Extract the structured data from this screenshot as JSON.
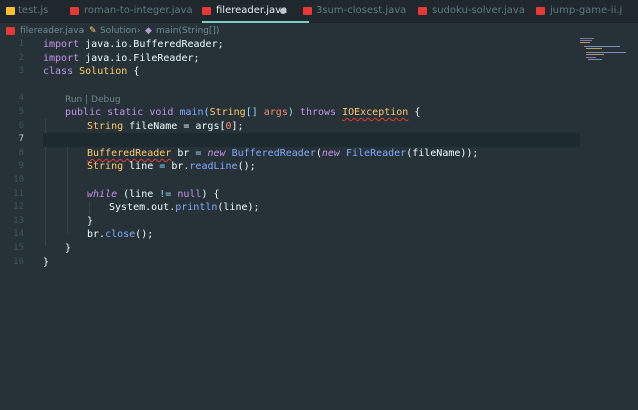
{
  "tabs": [
    {
      "label": "test.js",
      "icon": "js-file-icon",
      "active": false
    },
    {
      "label": "roman-to-integer.java",
      "icon": "java-file-icon",
      "active": false
    },
    {
      "label": "filereader.java",
      "icon": "java-file-icon",
      "active": true,
      "modified": true
    },
    {
      "label": "3sum-closest.java",
      "icon": "java-file-icon",
      "active": false
    },
    {
      "label": "sudoku-solver.java",
      "icon": "java-file-icon",
      "active": false
    },
    {
      "label": "jump-game-ii.j",
      "icon": "java-file-icon",
      "active": false
    }
  ],
  "breadcrumb": {
    "file": "filereader.java",
    "sep1": "›",
    "class": "Solution",
    "sep2": "›",
    "method": "main(String[])"
  },
  "line_numbers": [
    "1",
    "2",
    "3",
    "4",
    "5",
    "6",
    "7",
    "8",
    "9",
    "10",
    "11",
    "12",
    "13",
    "14",
    "15",
    "16"
  ],
  "current_line": "7",
  "codelens": "Run | Debug",
  "code": {
    "l1": {
      "kw": "import",
      "rest": " java.io.BufferedReader;"
    },
    "l2": {
      "kw": "import",
      "rest": " java.io.FileReader;"
    },
    "l3": {
      "kw": "class",
      "name": "Solution",
      "brace": "{"
    },
    "l5": {
      "public": "public",
      "static": "static",
      "void": "void",
      "fn": "main",
      "p1": "(",
      "type": "String",
      "arr": "[]",
      "arg": "args",
      "p2": ")",
      "throws": "throws",
      "exc": "IOException",
      "brace": "{"
    },
    "l6": {
      "type": "String",
      "rest": "fileName = args[",
      "num": "0",
      "end": "];"
    },
    "l8": {
      "type": "BufferedReader",
      "var": "br",
      "eq": "=",
      "new1": "new",
      "ctor1": "BufferedReader",
      "p1": "(",
      "new2": "new",
      "ctor2": "FileReader",
      "args": "(fileName));"
    },
    "l9": {
      "type": "String",
      "var": "line",
      "eq": "=",
      "obj": "br.",
      "fn": "readLine",
      "end": "();"
    },
    "l11": {
      "kw": "while",
      "open": "(line",
      "op": "!=",
      "null": "null",
      "close": ") {"
    },
    "l12": {
      "obj": "System.out.",
      "fn": "println",
      "end": "(line);"
    },
    "l13": {
      "brace": "}"
    },
    "l14": {
      "obj": "br.",
      "fn": "close",
      "end": "();"
    },
    "l15": {
      "brace": "}"
    },
    "l16": {
      "brace": "}"
    }
  },
  "colors": {
    "background": "#263238",
    "keyword": "#c792ea",
    "type": "#ffcb6b",
    "function": "#82aaff",
    "number": "#f78c6c",
    "accent": "#80cbc4"
  }
}
